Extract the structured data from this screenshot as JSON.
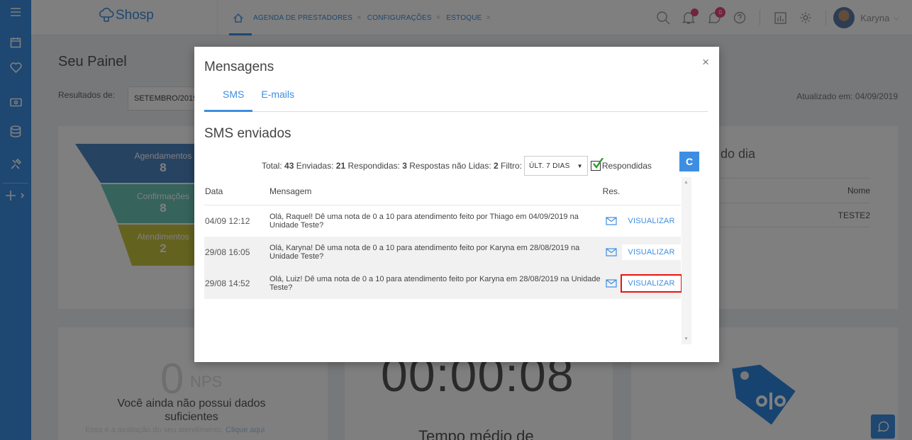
{
  "app": {
    "logo_text": "Shosp"
  },
  "nav": {
    "tabs": [
      {
        "label": "AGENDA DE PRESTADORES"
      },
      {
        "label": "CONFIGURAÇÕES"
      },
      {
        "label": "ESTOQUE"
      }
    ],
    "close_glyph": "×"
  },
  "header": {
    "notifications_badge": "0",
    "user_name": "Karyna"
  },
  "page": {
    "title": "Seu Painel",
    "results_label": "Resultados de:",
    "month_value": "SETEMBRO/2019",
    "updated_at": "Atualizado em: 04/09/2019"
  },
  "funnel": [
    {
      "label": "Agendamentos",
      "value": "8",
      "color": "#4f87c4"
    },
    {
      "label": "Confirmações",
      "value": "8",
      "color": "#6cc7b8"
    },
    {
      "label": "Atendimentos",
      "value": "2",
      "color": "#c9c43f"
    }
  ],
  "right_panel": {
    "title": "do dia",
    "col_name": "Nome",
    "row_value": "TESTE2"
  },
  "nps": {
    "value": "0",
    "label": "NPS",
    "message": "Você ainda não possui dados suficientes",
    "subtext": "Essa é a avaliação do seu atendimento.",
    "link": "Clique aqui"
  },
  "timer": {
    "value": "00:00:08",
    "label": "Tempo médio de"
  },
  "modal": {
    "title": "Mensagens",
    "close_glyph": "×",
    "tabs": [
      {
        "label": "SMS",
        "active": true
      },
      {
        "label": "E-mails",
        "active": false
      }
    ],
    "section_title": "SMS enviados",
    "summary": {
      "total_label": "Total:",
      "total": "43",
      "sent_label": "Enviadas:",
      "sent": "21",
      "answered_label": "Respondidas:",
      "answered": "3",
      "unread_label": "Respostas não Lidas:",
      "unread": "2",
      "filter_label": "Filtro:"
    },
    "filter_value": "ÚLT. 7 DIAS",
    "checkbox_label": "Respondidas",
    "refresh_glyph": "C",
    "table": {
      "headers": {
        "date": "Data",
        "message": "Mensagem",
        "res": "Res."
      },
      "rows": [
        {
          "date": "04/09 12:12",
          "message": "Olá, Raquel! Dê uma nota de 0 a 10 para atendimento feito por Thiago em 04/09/2019 na Unidade Teste?",
          "action": "VISUALIZAR"
        },
        {
          "date": "29/08 16:05",
          "message": "Olá, Karyna! Dê uma nota de 0 a 10 para atendimento feito por Karyna em 28/08/2019 na Unidade Teste?",
          "action": "VISUALIZAR"
        },
        {
          "date": "29/08 14:52",
          "message": "Olá, Luiz! Dê uma nota de 0 a 10 para atendimento feito por Karyna em 28/08/2019 na Unidade Teste?",
          "action": "VISUALIZAR"
        }
      ]
    }
  }
}
